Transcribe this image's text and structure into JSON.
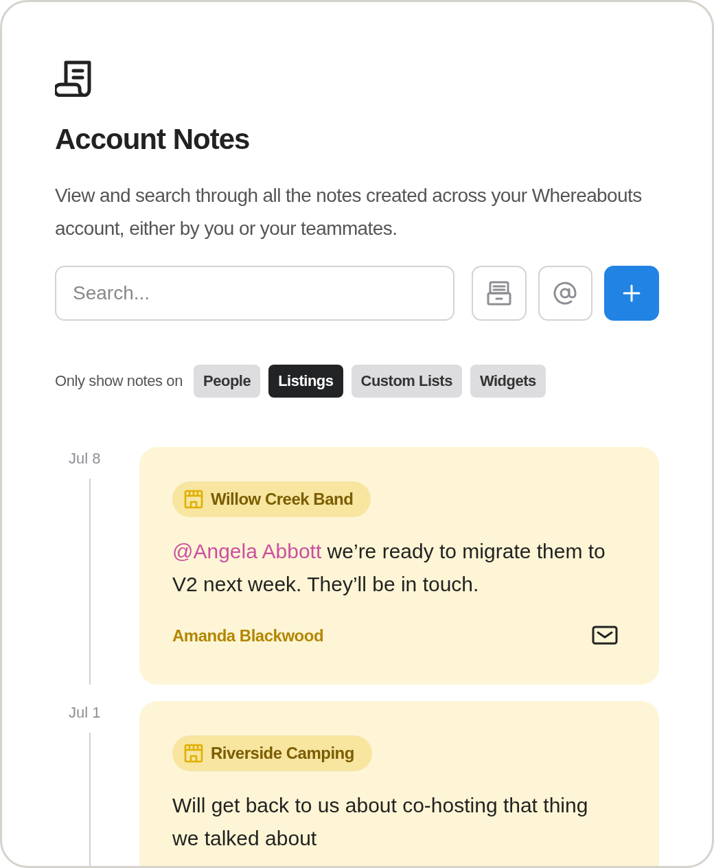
{
  "header": {
    "title": "Account Notes",
    "description": "View and search through all the notes created across your Whereabouts account, either by you or your teammates."
  },
  "search": {
    "placeholder": "Search..."
  },
  "filters": {
    "label": "Only show notes on",
    "options": [
      {
        "label": "People",
        "selected": false
      },
      {
        "label": "Listings",
        "selected": true
      },
      {
        "label": "Custom Lists",
        "selected": false
      },
      {
        "label": "Widgets",
        "selected": false
      }
    ]
  },
  "notes": [
    {
      "date": "Jul 8",
      "tag": "Willow Creek Band",
      "mention": "@Angela Abbott",
      "text": " we’re ready to migrate them to V2 next week. They’ll be in touch.",
      "author": "Amanda Blackwood"
    },
    {
      "date": "Jul 1",
      "tag": "Riverside Camping",
      "text": "Will get back to us about co-hosting that thing we talked about"
    }
  ]
}
